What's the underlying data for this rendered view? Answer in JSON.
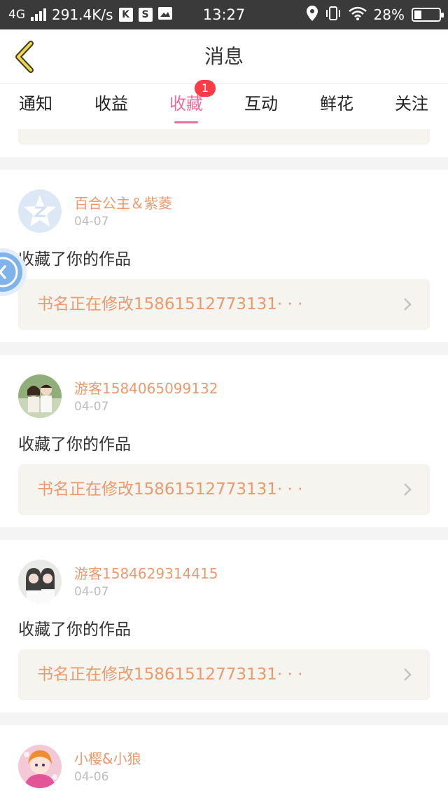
{
  "status_bar": {
    "network": "4G",
    "speed": "291.4K/s",
    "icon_k": "K",
    "icon_s": "S",
    "time": "13:27",
    "battery": "28%"
  },
  "nav": {
    "title": "消息"
  },
  "tabs": [
    {
      "label": "通知"
    },
    {
      "label": "收益"
    },
    {
      "label": "收藏",
      "badge": "1"
    },
    {
      "label": "互动"
    },
    {
      "label": "鲜花"
    },
    {
      "label": "关注"
    }
  ],
  "messages": [
    {
      "name": "百合公主＆紫菱",
      "date": "04-07",
      "action": "收藏了你的作品",
      "book": "书名正在修改15861512773131· · ·",
      "avatar": "qq-default-avatar"
    },
    {
      "name": "游客1584065099132",
      "date": "04-07",
      "action": "收藏了你的作品",
      "book": "书名正在修改15861512773131· · ·",
      "avatar": "couple-photo-avatar"
    },
    {
      "name": "游客1584629314415",
      "date": "04-07",
      "action": "收藏了你的作品",
      "book": "书名正在修改15861512773131· · ·",
      "avatar": "girls-photo-avatar"
    },
    {
      "name": "小樱&小狼",
      "date": "04-06",
      "action": "",
      "book": "",
      "avatar": "anime-avatar"
    }
  ],
  "colors": {
    "accent": "#e76f9b",
    "name": "#eb9a6e",
    "badge": "#ff3b46",
    "book_bg": "#f5f4ee"
  }
}
